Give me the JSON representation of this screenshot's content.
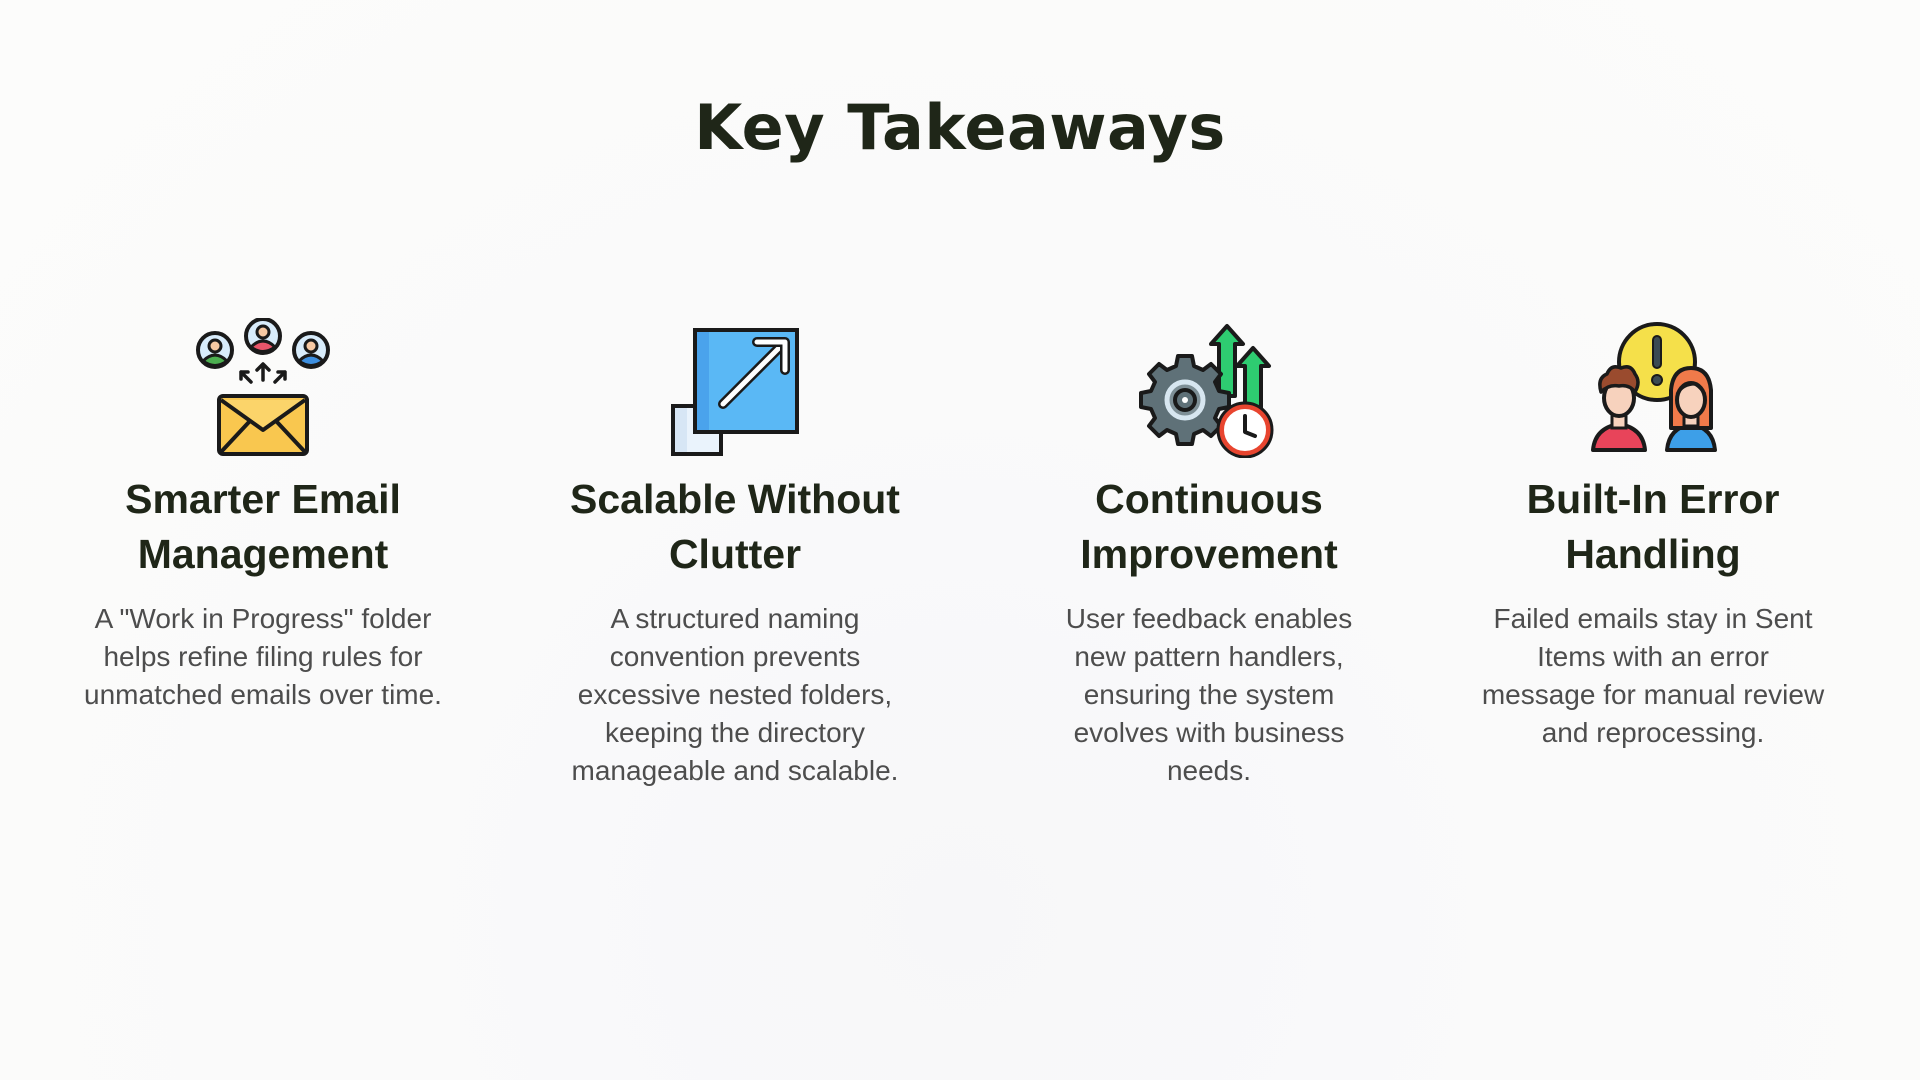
{
  "page": {
    "title": "Key Takeaways"
  },
  "cards": [
    {
      "icon": "email-distribution-icon",
      "heading": "Smarter Email Management",
      "body": "A \"Work in Progress\" folder helps refine filing rules for unmatched emails over time."
    },
    {
      "icon": "expand-scale-icon",
      "heading": "Scalable Without Clutter",
      "body": "A structured naming convention prevents excessive nested folders, keeping the directory manageable and scalable."
    },
    {
      "icon": "gear-growth-clock-icon",
      "heading": "Continuous Improvement",
      "body": "User feedback enables new pattern handlers, ensuring the system evolves with business needs."
    },
    {
      "icon": "people-alert-icon",
      "heading": "Built-In Error Handling",
      "body": "Failed emails stay in Sent Items with an error message for manual review and reprocessing."
    }
  ],
  "colors": {
    "heading": "#1f2618",
    "body_text": "#4d4d4d",
    "background": "#fbfbfa",
    "envelope_yellow": "#f9c74f",
    "blue": "#5ab8f5",
    "green_arrow": "#2ecc71",
    "alert_yellow": "#f5e04a",
    "red": "#e8445a"
  }
}
